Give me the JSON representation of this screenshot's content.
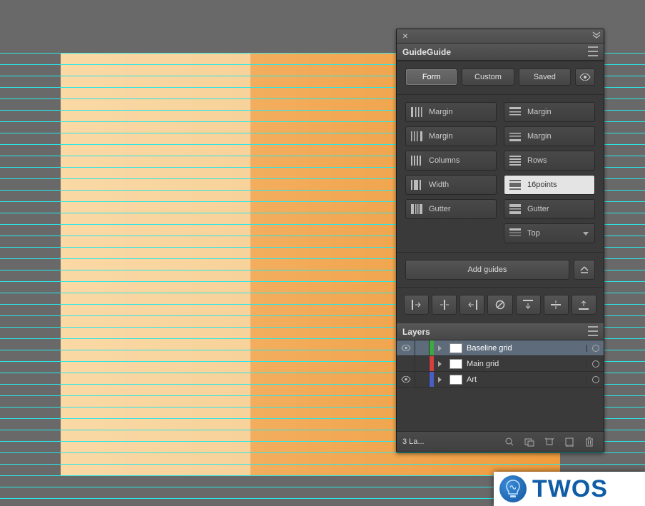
{
  "panel": {
    "title": "GuideGuide"
  },
  "tabs": {
    "form": "Form",
    "custom": "Custom",
    "saved": "Saved"
  },
  "form": {
    "margin_left": "Margin",
    "margin_right": "Margin",
    "margin_top": "Margin",
    "margin_bottom": "Margin",
    "columns": "Columns",
    "rows": "Rows",
    "col_width": "Width",
    "row_height": "16points",
    "col_gutter": "Gutter",
    "row_gutter": "Gutter",
    "calc_from": "Top"
  },
  "actions": {
    "add": "Add guides"
  },
  "layers": {
    "title": "Layers",
    "items": [
      {
        "name": "Baseline grid",
        "color": "#3fa83f",
        "visible": true,
        "selected": true
      },
      {
        "name": "Main grid",
        "color": "#d43f3f",
        "visible": false,
        "selected": false
      },
      {
        "name": "Art",
        "color": "#4a5ec4",
        "visible": true,
        "selected": false
      }
    ],
    "count": "3 La..."
  },
  "brand": {
    "text": "TWOS"
  }
}
